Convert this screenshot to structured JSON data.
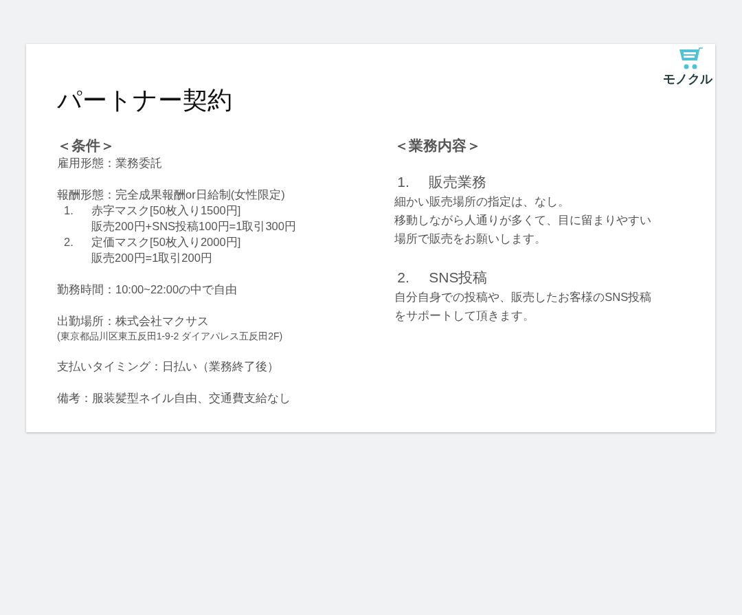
{
  "slide": {
    "title": "パートナー契約",
    "logo_text": "モノクル",
    "conditions": {
      "heading": "＜条件＞",
      "sections": [
        {
          "lines": [
            {
              "kind": "text",
              "text": "雇用形態：業務委託"
            }
          ]
        },
        {
          "lines": [
            {
              "kind": "text",
              "text": "報酬形態：完全成果報酬or日給制(女性限定)"
            },
            {
              "kind": "numbered",
              "number": "1.",
              "text": "赤字マスク[50枚入り1500円]"
            },
            {
              "kind": "continuation",
              "text": "販売200円+SNS投稿100円=1取引300円"
            },
            {
              "kind": "numbered",
              "number": "2.",
              "text": "定価マスク[50枚入り2000円]"
            },
            {
              "kind": "continuation",
              "text": "販売200円=1取引200円"
            }
          ]
        },
        {
          "lines": [
            {
              "kind": "text",
              "text": "勤務時間：10:00~22:00の中で自由"
            }
          ]
        },
        {
          "lines": [
            {
              "kind": "text",
              "text": "出勤場所：株式会社マクサス"
            },
            {
              "kind": "small",
              "text": "(東京都品川区東五反田1-9-2 ダイアパレス五反田2F)"
            }
          ]
        },
        {
          "lines": [
            {
              "kind": "text",
              "text": "支払いタイミング：日払い（業務終了後）"
            }
          ]
        },
        {
          "lines": [
            {
              "kind": "text",
              "text": "備考：服装髪型ネイル自由、交通費支給なし"
            }
          ]
        }
      ]
    },
    "duties": {
      "heading": "＜業務内容＞",
      "items": [
        {
          "number": "1.",
          "title": "販売業務",
          "lines": [
            "細かい販売場所の指定は、なし。",
            "移動しながら人通りが多くて、目に留まりやすい",
            "場所で販売をお願いします。"
          ]
        },
        {
          "number": "2.",
          "title": "SNS投稿",
          "lines": [
            "自分自身での投稿や、販売したお客様のSNS投稿",
            "をサポートして頂きます。"
          ]
        }
      ]
    }
  }
}
